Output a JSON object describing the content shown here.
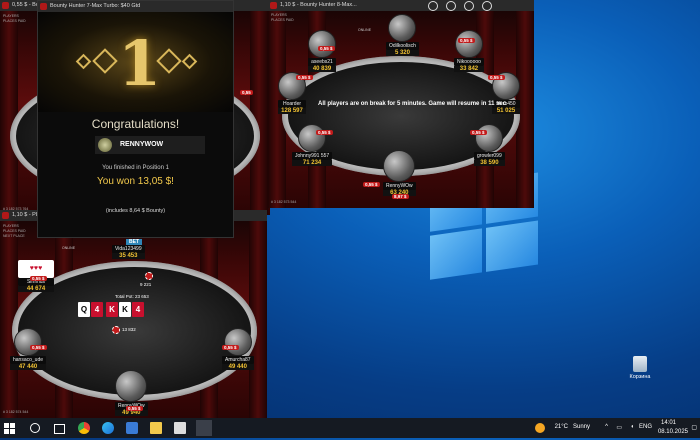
{
  "desktop": {
    "recycle_bin_label": "Корзина"
  },
  "window_back_left": {
    "title": "0,55 $ - Bo",
    "left_labels": [
      "PLAYERS",
      "PLACES PAID",
      "NEXT PLACE"
    ],
    "side_small": "# 3 182 573 764",
    "stack_stub": "0,55"
  },
  "window_congrats": {
    "title": "Bounty Hunter 7-Max Turbo: $40 Gtd",
    "place_number": "1",
    "headline": "Congratulations!",
    "player": "RENNYWOW",
    "position_text": "You finished in Position 1",
    "won_text": "You won 13,05 $!",
    "includes_text": "(includes 8,64 $ Bounty)"
  },
  "window_right": {
    "title": "1,10 $ - Bounty Hunter 8-Max...",
    "top_labels": [
      "PLAYERS",
      "PLACES PAID",
      "NEXT PLACE"
    ],
    "online_label": "ONLINE",
    "side_small": "# 3 182 573 544",
    "message": "All players are on break for 5 minutes. Game will resume in 11 sec",
    "seats": [
      {
        "name": "Odilkoolisch",
        "stack": "5 320",
        "bounty": ""
      },
      {
        "name": "aseebs21",
        "stack": "40 839",
        "bounty": "0,55 $"
      },
      {
        "name": "Nikoooooo",
        "stack": "33 842",
        "bounty": "0,55 $"
      },
      {
        "name": "Hoarder",
        "stack": "128 597",
        "bounty": "0,55 $"
      },
      {
        "name": "Herb450",
        "stack": "51 025",
        "bounty": "0,55 $"
      },
      {
        "name": "Johnny991 557",
        "stack": "71 234",
        "bounty": "0,55 $"
      },
      {
        "name": "growler099",
        "stack": "38 590",
        "bounty": "0,55 $"
      },
      {
        "name": "RennyWOw",
        "stack": "63 240",
        "bounty": "0,55 $"
      }
    ],
    "hero_bounty": "8,97 $"
  },
  "window_bottom": {
    "title": "1,10 $ - PL",
    "left_labels": [
      "PLAYERS",
      "PLACES PAID",
      "NEXT PLACE"
    ],
    "online_label": "ONLINE",
    "side_small": "# 3 182 574 544",
    "bet_label": "BET",
    "pot_text": "Total Pot: 23 653",
    "pot_chips": "13 832",
    "bet_amount": "9 221",
    "board_cards": [
      {
        "rank": "Q",
        "suit": "♠",
        "red": false
      },
      {
        "rank": "K",
        "suit": "♥",
        "red": true
      },
      {
        "rank": "K",
        "suit": "♠",
        "red": false
      },
      {
        "rank": "4",
        "suit": "♥",
        "red": true
      }
    ],
    "hole_cards": [
      {
        "rank": "Q",
        "suit": "♠",
        "red": false
      },
      {
        "rank": "4",
        "suit": "♥",
        "red": true
      }
    ],
    "seats": [
      {
        "name": "Vida123499",
        "stack": "35 453",
        "bounty": ""
      },
      {
        "name": "Simmus",
        "stack": "44 674",
        "bounty": "0,55 $"
      },
      {
        "name": "hansaco_ude",
        "stack": "47 440",
        "bounty": "0,55 $"
      },
      {
        "name": "Amurcha87",
        "stack": "49 440",
        "bounty": "0,55 $"
      },
      {
        "name": "RennyWOw",
        "stack": "49 940",
        "bounty": "0,55 $"
      }
    ]
  },
  "taskbar": {
    "weather_temp": "21°C",
    "weather_desc": "Sunny",
    "lang": "ENG",
    "time": "14:01",
    "date": "08.10.2025"
  },
  "colors": {
    "accent_gold": "#f1c232",
    "bounty_red": "#c21b1b",
    "desktop_blue": "#0a5fb8"
  }
}
